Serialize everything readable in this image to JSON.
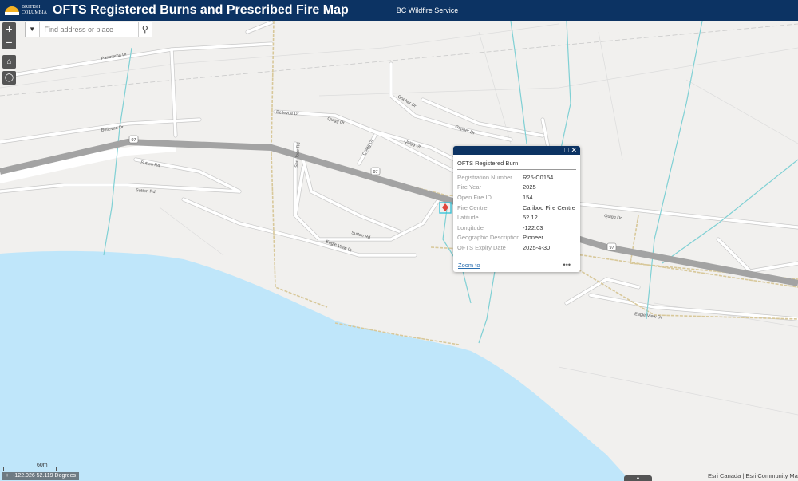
{
  "header": {
    "logo_text": "BRITISH COLUMBIA",
    "title": "OFTS Registered Burns and Prescribed Fire Map",
    "subtitle": "BC Wildfire Service"
  },
  "controls": {
    "zoom_in": "+",
    "zoom_out": "−",
    "home_icon": "home-icon",
    "locate_icon": "locate-icon"
  },
  "search": {
    "placeholder": "Find address or place",
    "value": ""
  },
  "map": {
    "road_labels": [
      "Panorama Dr",
      "Bellevue Dr",
      "Bellevue Dr",
      "Quigg Dr",
      "Quigg Dr",
      "Quigg Dr",
      "Gopher Dr",
      "Gopher Dr",
      "Sutton Rd",
      "Sutton Rd",
      "Sutton Rd",
      "Eagle View Dr",
      "Eagle View Dr",
      "Quigg Dr",
      "San Jose Rd"
    ],
    "highway_shield": "97"
  },
  "popup": {
    "title": "OFTS Registered Burn",
    "fields": [
      {
        "label": "Registration Number",
        "value": "R25-C0154"
      },
      {
        "label": "Fire Year",
        "value": "2025"
      },
      {
        "label": "Open Fire ID",
        "value": "154"
      },
      {
        "label": "Fire Centre",
        "value": "Cariboo Fire Centre"
      },
      {
        "label": "Latitude",
        "value": "52.12"
      },
      {
        "label": "Longitude",
        "value": "-122.03"
      },
      {
        "label": "Geographic Description",
        "value": "Pioneer"
      },
      {
        "label": "OFTS Expiry Date",
        "value": "2025-4-30"
      }
    ],
    "zoom_to": "Zoom to",
    "more": "•••"
  },
  "scale": {
    "label": "60m"
  },
  "coordinates": {
    "icon": "+",
    "text": "-122.026 52.119 Degrees"
  },
  "attribution": "Esri Canada | Esri Community Maps"
}
